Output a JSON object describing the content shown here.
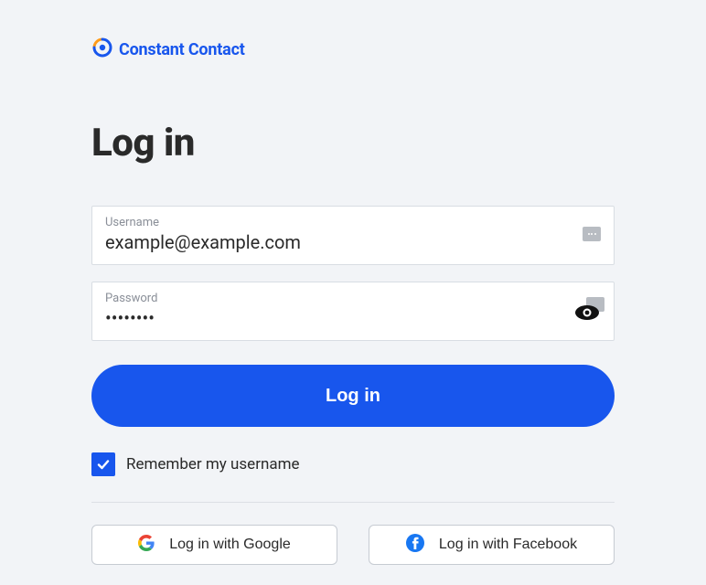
{
  "brand": {
    "name": "Constant Contact"
  },
  "heading": "Log in",
  "username": {
    "label": "Username",
    "value": "example@example.com"
  },
  "password": {
    "label": "Password",
    "value": "••••••••"
  },
  "submit_label": "Log in",
  "remember": {
    "label": "Remember my username",
    "checked": true
  },
  "social": {
    "google": "Log in with Google",
    "facebook": "Log in with Facebook"
  },
  "colors": {
    "primary": "#1856ed",
    "accent": "#ff9b1a"
  }
}
